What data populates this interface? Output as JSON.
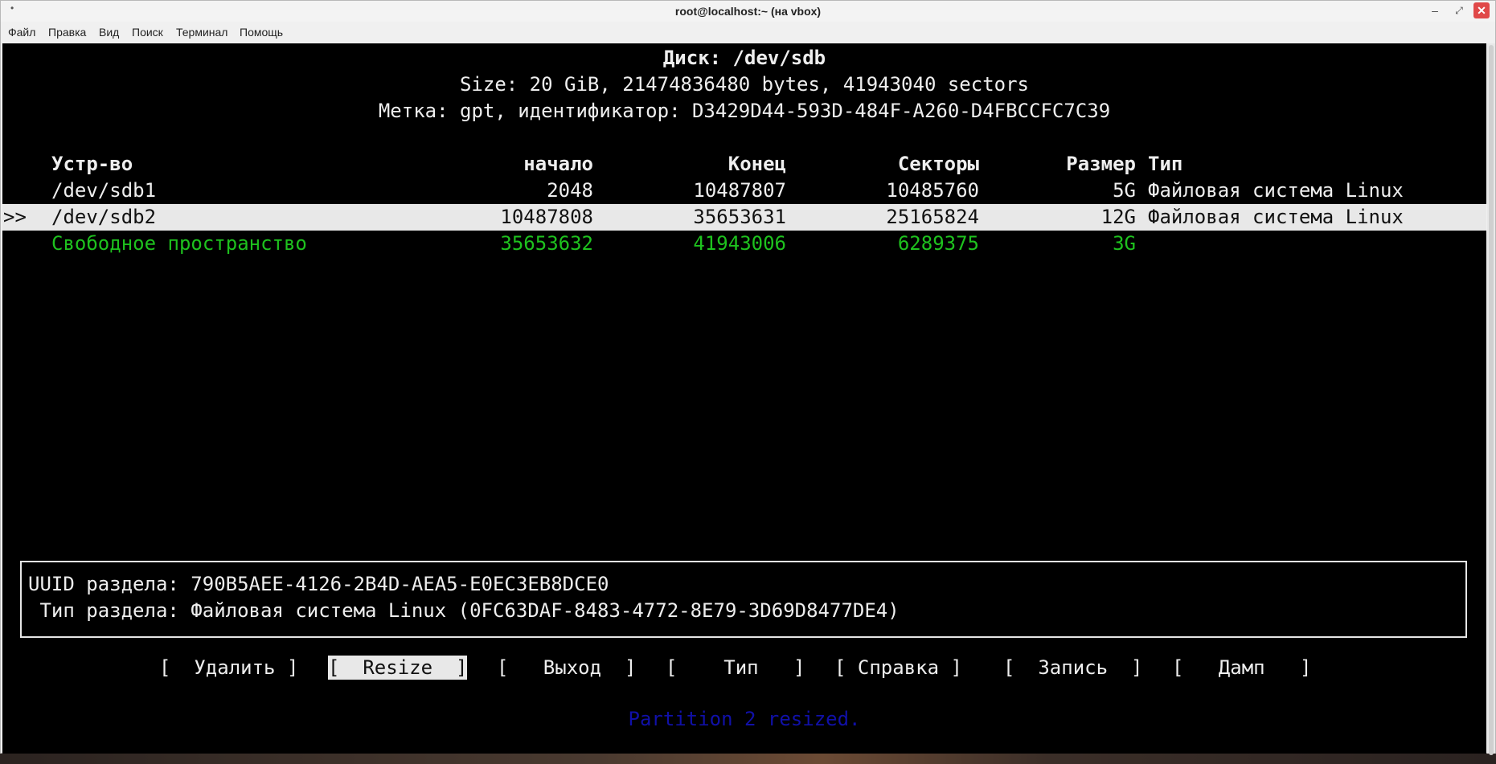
{
  "window": {
    "title": "root@localhost:~ (на vbox)",
    "menu": [
      "Файл",
      "Правка",
      "Вид",
      "Поиск",
      "Терминал",
      "Помощь"
    ]
  },
  "disk": {
    "heading": "Диск: /dev/sdb",
    "size_line": "Size: 20 GiB, 21474836480 bytes, 41943040 sectors",
    "label_line": "Метка: gpt, идентификатор: D3429D44-593D-484F-A260-D4FBCCFC7C39"
  },
  "table": {
    "headers": {
      "device": "Устр-во",
      "start": "начало",
      "end": "Конец",
      "sectors": "Секторы",
      "size": "Размер",
      "type": "Тип"
    },
    "rows": [
      {
        "marker": "",
        "device": "/dev/sdb1",
        "start": "2048",
        "end": "10487807",
        "sectors": "10485760",
        "size": "5G",
        "type": "Файловая система Linux"
      },
      {
        "marker": ">>",
        "device": "/dev/sdb2",
        "start": "10487808",
        "end": "35653631",
        "sectors": "25165824",
        "size": "12G",
        "type": "Файловая система Linux"
      },
      {
        "marker": "",
        "device": "Свободное пространство",
        "start": "35653632",
        "end": "41943006",
        "sectors": "6289375",
        "size": "3G",
        "type": ""
      }
    ]
  },
  "info": {
    "uuid_line": "UUID раздела: 790B5AEE-4126-2B4D-AEA5-E0EC3EB8DCE0",
    "type_line": " Тип раздела: Файловая система Linux (0FC63DAF-8483-4772-8E79-3D69D8477DE4)"
  },
  "buttons": {
    "delete": "[  Удалить ]",
    "resize": "[  Resize  ]",
    "quit": "[   Выход  ]",
    "type": "[    Тип   ]",
    "help": "[ Справка ]",
    "write": "[  Запись  ]",
    "dump": "[   Дамп   ]"
  },
  "status": "Partition 2 resized.",
  "colors": {
    "terminal_bg": "#000000",
    "terminal_fg": "#eeeeee",
    "selection_bg": "#e8e8e8",
    "free_space": "#1ec21e",
    "status": "#1010a8",
    "close_button": "#e04848"
  }
}
